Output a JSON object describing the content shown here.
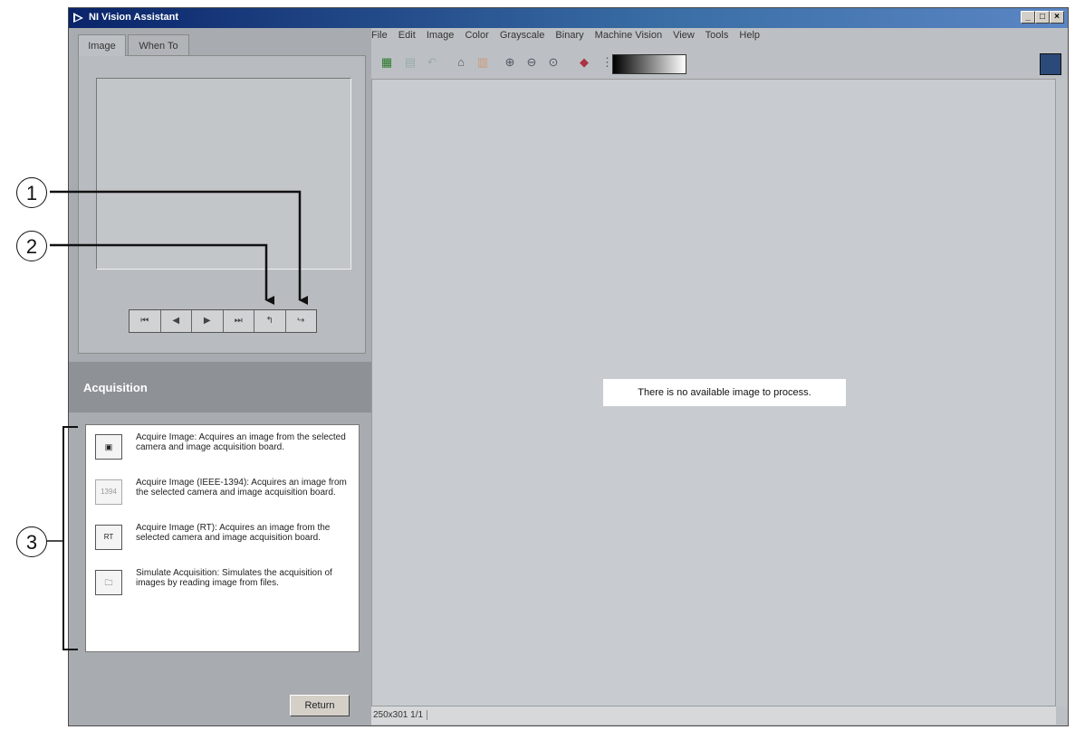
{
  "window": {
    "title": "NI Vision Assistant"
  },
  "tabs": [
    "Image",
    "When To"
  ],
  "nav_buttons": [
    "⏮",
    "◀",
    "▶",
    "⏭",
    "↰",
    "↪"
  ],
  "acquisition": {
    "title": "Acquisition",
    "items": [
      {
        "icon": "camera-icon",
        "text": "Acquire Image:  Acquires an image from the selected camera and image acquisition board."
      },
      {
        "icon": "ieee1394-camera-icon",
        "icon_label": "1394",
        "text": "Acquire Image (IEEE-1394):  Acquires an image from the selected camera and image acquisition board."
      },
      {
        "icon": "rt-camera-icon",
        "icon_label": "RT",
        "text": "Acquire Image (RT):  Acquires an image from the selected camera and image acquisition board."
      },
      {
        "icon": "folder-image-icon",
        "text": "Simulate Acquisition:  Simulates the acquisition of images by reading image from files."
      }
    ],
    "return_label": "Return"
  },
  "menu": [
    "File",
    "Edit",
    "Image",
    "Color",
    "Grayscale",
    "Binary",
    "Machine Vision",
    "View",
    "Tools",
    "Help"
  ],
  "canvas": {
    "message": "There is no available image to process."
  },
  "status": {
    "dimensions": "250x301 1/1"
  },
  "callouts": [
    "1",
    "2",
    "3"
  ]
}
